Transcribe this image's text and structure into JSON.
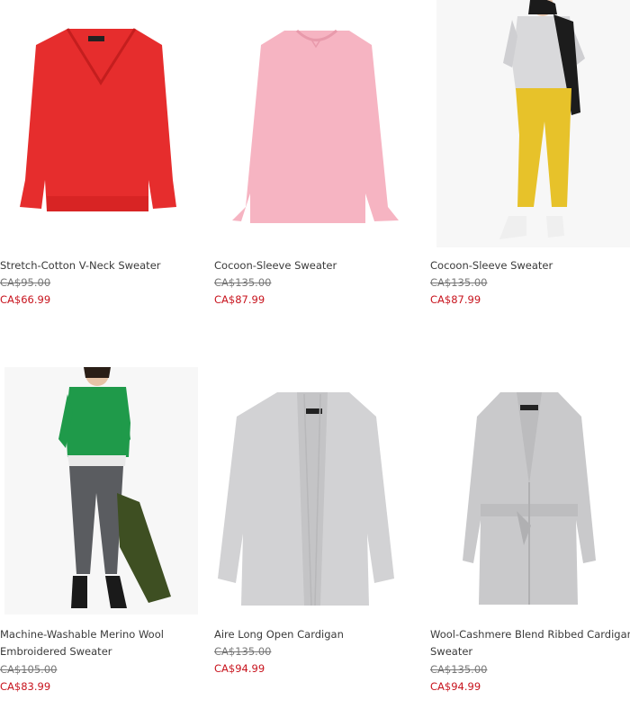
{
  "products": [
    {
      "name": "Stretch-Cotton V-Neck Sweater",
      "original_price": "CA$95.00",
      "sale_price": "CA$66.99",
      "image_icon": "red-vneck-sweater"
    },
    {
      "name": "Cocoon-Sleeve Sweater",
      "original_price": "CA$135.00",
      "sale_price": "CA$87.99",
      "image_icon": "pink-sweater"
    },
    {
      "name": "Cocoon-Sleeve Sweater",
      "original_price": "CA$135.00",
      "sale_price": "CA$87.99",
      "image_icon": "model-grey-sweater-yellow-pants"
    },
    {
      "name": "Machine-Washable Merino Wool Embroidered Sweater",
      "original_price": "CA$105.00",
      "sale_price": "CA$83.99",
      "image_icon": "model-green-sweater"
    },
    {
      "name": "Aire Long Open Cardigan",
      "original_price": "CA$135.00",
      "sale_price": "CA$94.99",
      "image_icon": "grey-open-cardigan"
    },
    {
      "name": "Wool-Cashmere Blend Ribbed Cardigan Sweater",
      "original_price": "CA$135.00",
      "sale_price": "CA$94.99",
      "image_icon": "grey-belted-cardigan"
    }
  ],
  "colors": {
    "sale": "#c8141e",
    "original": "#777777",
    "text": "#3a3a3a"
  }
}
